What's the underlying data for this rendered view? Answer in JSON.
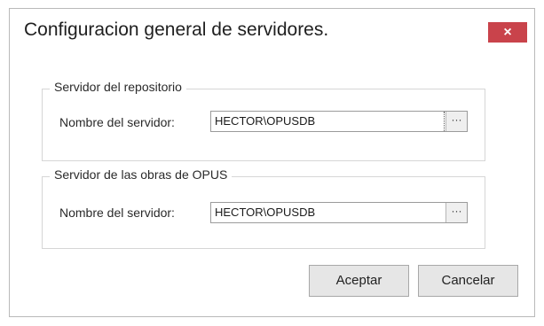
{
  "window": {
    "title": "Configuracion general de servidores.",
    "close_glyph": "×"
  },
  "repository_group": {
    "legend": "Servidor del repositorio",
    "field_label": "Nombre del servidor:",
    "server_value": "HECTOR\\OPUSDB",
    "browse_label": "···"
  },
  "works_group": {
    "legend": "Servidor de las obras de OPUS",
    "field_label": "Nombre del servidor:",
    "server_value": "HECTOR\\OPUSDB",
    "browse_label": "···"
  },
  "buttons": {
    "accept_label": "Aceptar",
    "cancel_label": "Cancelar"
  },
  "colors": {
    "close_button": "#c9434b",
    "group_border": "#d6d6d6"
  },
  "icons": {
    "close": "close-icon"
  }
}
